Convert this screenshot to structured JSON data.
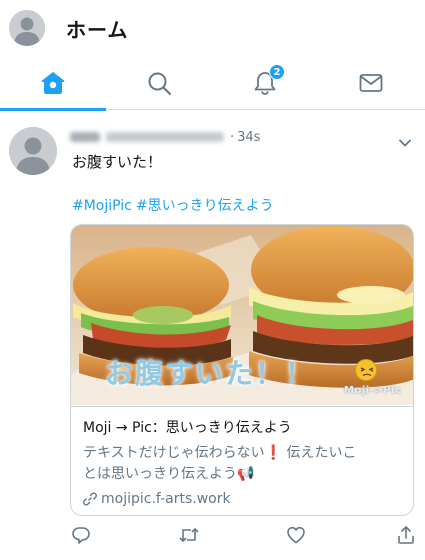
{
  "header": {
    "title": "ホーム",
    "avatar_icon": "default-avatar-icon"
  },
  "tabs": [
    {
      "name": "home",
      "icon": "home-icon",
      "active": true
    },
    {
      "name": "search",
      "icon": "search-icon",
      "active": false
    },
    {
      "name": "notifications",
      "icon": "bell-icon",
      "badge": "2",
      "active": false
    },
    {
      "name": "messages",
      "icon": "mail-icon",
      "active": false
    }
  ],
  "tweet": {
    "time": "34s",
    "separator": "·",
    "text": "お腹すいた！",
    "hashtags": [
      "#MojiPic",
      "#思いっきり伝えよう"
    ],
    "card": {
      "image_overlay_text": "お腹すいた！！",
      "image_watermark": "Moji->Pic",
      "title": "Moji → Pic：思いっきり伝えよう",
      "description_line1_before": "テキストだけじゃ伝わらない",
      "description_exclaim": "❗",
      "description_line1_after": " 伝えたいこ",
      "description_line2": "とは思いっきり伝えよう📢",
      "url": "mojipic.f-arts.work"
    }
  },
  "colors": {
    "accent": "#1da1f2",
    "text_primary": "#14171a",
    "text_secondary": "#657786",
    "border": "#ccd6dd"
  }
}
